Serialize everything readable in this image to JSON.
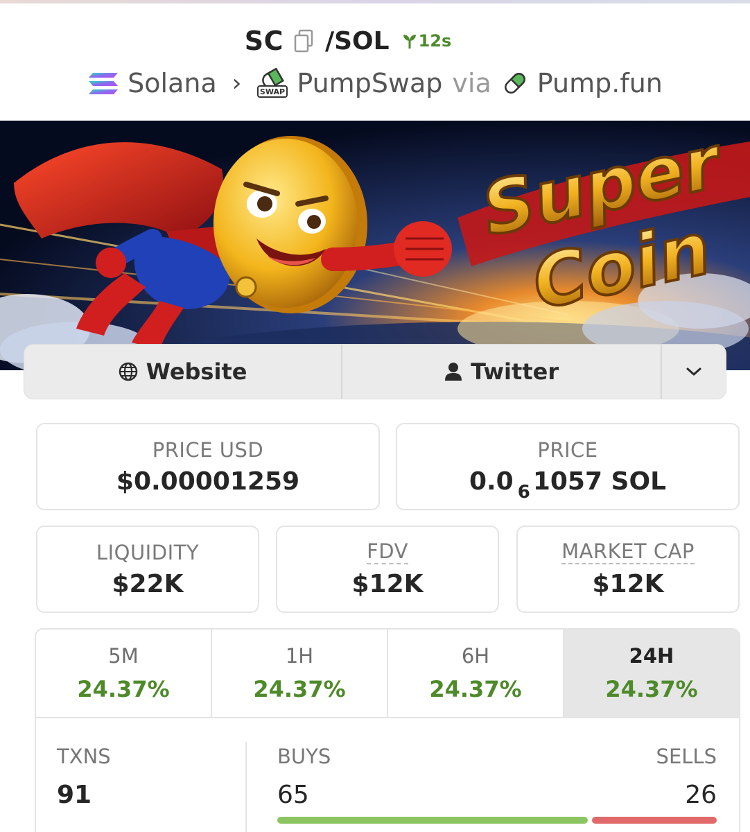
{
  "header": {
    "symbol": "SC",
    "quote": "/SOL",
    "age": "12s",
    "chain": "Solana",
    "dex": "PumpSwap",
    "via": "via",
    "launchpad": "Pump.fun",
    "swap_badge": "SWAP"
  },
  "banner": {
    "title_line1": "Super",
    "title_line2": "Coin"
  },
  "links": {
    "website": "Website",
    "twitter": "Twitter"
  },
  "stats": {
    "price_usd_label": "PRICE USD",
    "price_usd": "$0.00001259",
    "price_label": "PRICE",
    "price_prefix": "0.0",
    "price_zeros": "6",
    "price_suffix": "1057 SOL",
    "liquidity_label": "LIQUIDITY",
    "liquidity": "$22K",
    "fdv_label": "FDV",
    "fdv": "$12K",
    "mcap_label": "MARKET CAP",
    "mcap": "$12K"
  },
  "timeframes": [
    {
      "label": "5M",
      "value": "24.37%"
    },
    {
      "label": "1H",
      "value": "24.37%"
    },
    {
      "label": "6H",
      "value": "24.37%"
    },
    {
      "label": "24H",
      "value": "24.37%"
    }
  ],
  "txns": {
    "txns_label": "TXNS",
    "txns": "91",
    "buys_label": "BUYS",
    "buys": "65",
    "sells_label": "SELLS",
    "sells": "26",
    "buy_share": 0.714
  },
  "colors": {
    "positive": "#4e8a2a",
    "buy_bar": "#8cc462",
    "sell_bar": "#e06969"
  }
}
